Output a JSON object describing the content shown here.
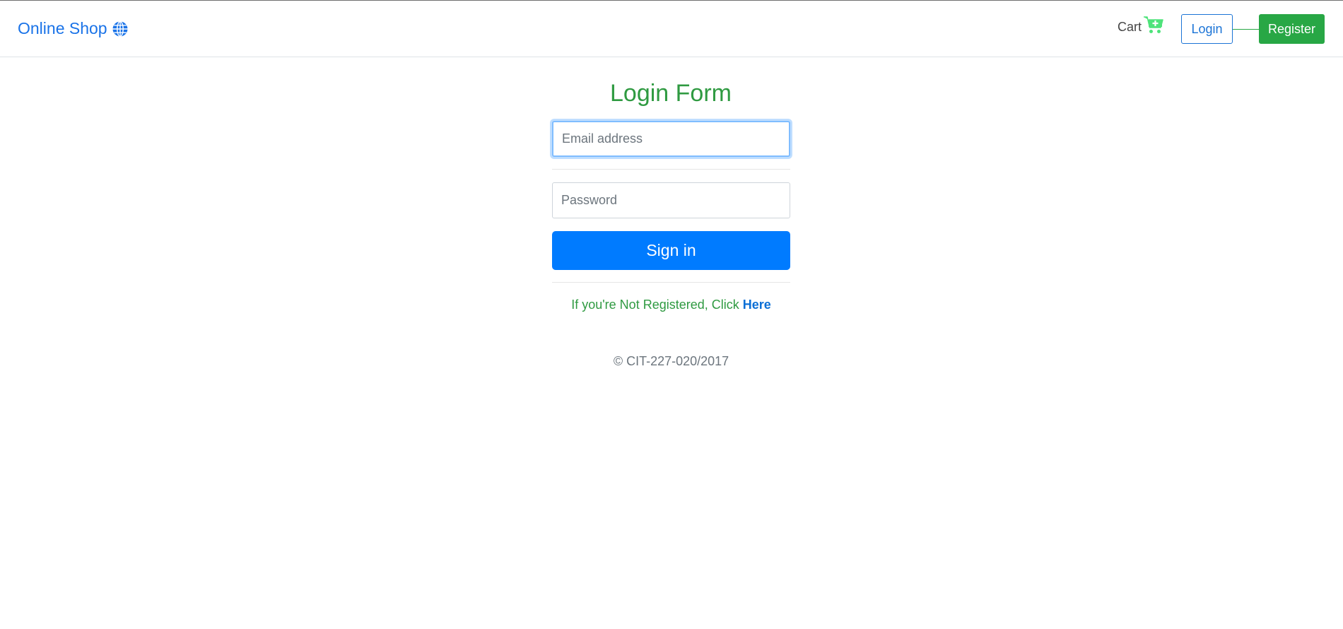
{
  "navbar": {
    "brand": "Online Shop",
    "brand_icon": "globe-icon",
    "cart_label": "Cart",
    "cart_icon": "cart-plus-icon",
    "login_label": "Login",
    "register_label": "Register"
  },
  "form": {
    "title": "Login Form",
    "email_placeholder": "Email address",
    "email_value": "",
    "password_placeholder": "Password",
    "password_value": "",
    "signin_label": "Sign in",
    "register_prompt": "If you're Not Registered, Click ",
    "register_link": "Here"
  },
  "footer": {
    "copyright": "© CIT-227-020/2017"
  },
  "colors": {
    "brand_blue": "#1a73e8",
    "success_green": "#28a745",
    "title_green": "#2f9a41",
    "primary_blue": "#007bff",
    "cart_icon_green": "#4ee37a"
  }
}
